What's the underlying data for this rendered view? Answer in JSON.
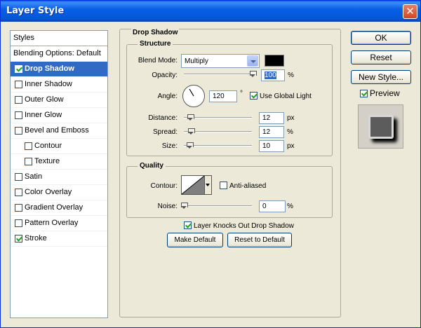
{
  "window": {
    "title": "Layer Style",
    "close_glyph": "✕"
  },
  "styles_list": {
    "header": "Styles",
    "blending": "Blending Options: Default",
    "items": [
      {
        "label": "Drop Shadow",
        "checked": true,
        "selected": true
      },
      {
        "label": "Inner Shadow",
        "checked": false
      },
      {
        "label": "Outer Glow",
        "checked": false
      },
      {
        "label": "Inner Glow",
        "checked": false
      },
      {
        "label": "Bevel and Emboss",
        "checked": false
      },
      {
        "label": "Contour",
        "checked": false,
        "indent": true
      },
      {
        "label": "Texture",
        "checked": false,
        "indent": true
      },
      {
        "label": "Satin",
        "checked": false
      },
      {
        "label": "Color Overlay",
        "checked": false
      },
      {
        "label": "Gradient Overlay",
        "checked": false
      },
      {
        "label": "Pattern Overlay",
        "checked": false
      },
      {
        "label": "Stroke",
        "checked": true
      }
    ]
  },
  "drop_shadow": {
    "title": "Drop Shadow",
    "structure": {
      "title": "Structure",
      "blend_mode_label": "Blend Mode:",
      "blend_mode": "Multiply",
      "shadow_color": "#000000",
      "opacity_label": "Opacity:",
      "opacity": "100",
      "opacity_unit": "%",
      "angle_label": "Angle:",
      "angle": "120",
      "angle_unit": "°",
      "use_global_light": "Use Global Light",
      "distance_label": "Distance:",
      "distance": "12",
      "distance_unit": "px",
      "spread_label": "Spread:",
      "spread": "12",
      "spread_unit": "%",
      "size_label": "Size:",
      "size": "10",
      "size_unit": "px"
    },
    "quality": {
      "title": "Quality",
      "contour_label": "Contour:",
      "anti_aliased": "Anti-aliased",
      "noise_label": "Noise:",
      "noise": "0",
      "noise_unit": "%"
    },
    "knockout": "Layer Knocks Out Drop Shadow",
    "make_default": "Make Default",
    "reset_default": "Reset to Default"
  },
  "side": {
    "ok": "OK",
    "reset": "Reset",
    "new_style": "New Style...",
    "preview": "Preview"
  }
}
